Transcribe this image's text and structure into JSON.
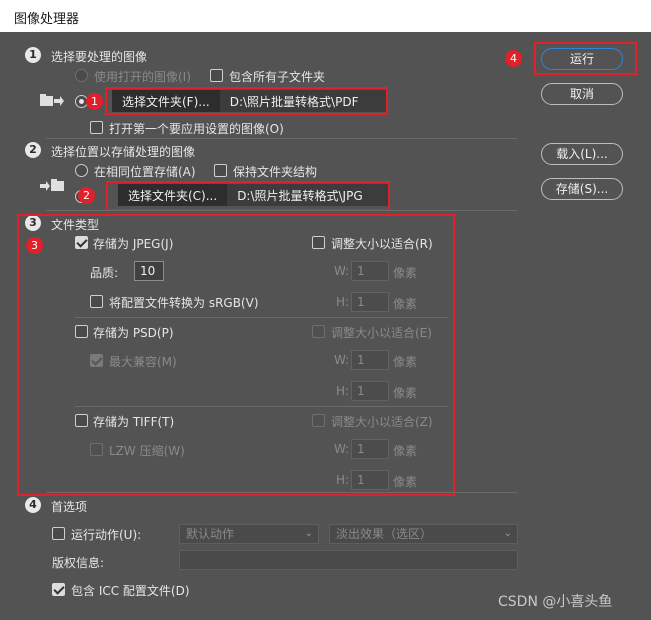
{
  "window": {
    "title": "图像处理器"
  },
  "annotations": {
    "n1": "1",
    "n2": "2",
    "n3": "3",
    "n4": "4"
  },
  "section1": {
    "num": "1",
    "title": "选择要处理的图像",
    "use_open": "使用打开的图像(I)",
    "include_sub": "包含所有子文件夹",
    "select_folder": "选择文件夹(F)...",
    "folder_path": "D:\\照片批量转格式\\PDF",
    "open_first": "打开第一个要应用设置的图像(O)"
  },
  "section2": {
    "num": "2",
    "title": "选择位置以存储处理的图像",
    "same_location": "在相同位置存储(A)",
    "keep_structure": "保持文件夹结构",
    "select_folder": "选择文件夹(C)...",
    "folder_path": "D:\\照片批量转格式\\JPG"
  },
  "section3": {
    "num": "3",
    "title": "文件类型",
    "jpeg": {
      "label": "存储为 JPEG(J)",
      "checked": true,
      "resize": "调整大小以适合(R)",
      "quality_label": "品质:",
      "quality": "10",
      "w_label": "W:",
      "w_value": "1",
      "h_label": "H:",
      "h_value": "1",
      "unit": "像素",
      "convert": "将配置文件转换为 sRGB(V)"
    },
    "psd": {
      "label": "存储为 PSD(P)",
      "resize": "调整大小以适合(E)",
      "max_compat": "最大兼容(M)",
      "w_label": "W:",
      "w_value": "1",
      "h_label": "H:",
      "h_value": "1",
      "unit": "像素"
    },
    "tiff": {
      "label": "存储为 TIFF(T)",
      "resize": "调整大小以适合(Z)",
      "lzw": "LZW 压缩(W)",
      "w_label": "W:",
      "w_value": "1",
      "h_label": "H:",
      "h_value": "1",
      "unit": "像素"
    }
  },
  "section4": {
    "num": "4",
    "title": "首选项",
    "run_action": "运行动作(U):",
    "action_set": "默认动作",
    "action_name": "淡出效果（选区）",
    "copyright_label": "版权信息:",
    "copyright_value": "",
    "include_icc": "包含 ICC 配置文件(D)"
  },
  "buttons": {
    "run": "运行",
    "cancel": "取消",
    "load": "载入(L)...",
    "save": "存储(S)..."
  },
  "watermark": "CSDN @小喜头鱼",
  "colors": {
    "annotation_red": "#e0202a",
    "dialog_bg": "#535353",
    "primary_border": "#2f86d9"
  }
}
